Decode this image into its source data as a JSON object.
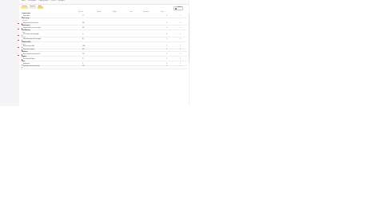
{
  "breadcrumb": [
    "Billing",
    "Cost allocation",
    "Usage by project",
    "Q4 2023",
    "All regions"
  ],
  "chips": [
    "Overview",
    "By project",
    "Alerts"
  ],
  "settings_label": "Settings",
  "columns": [
    "Total cost",
    "Forecast",
    "Budget",
    "Used",
    "Remaining",
    "Trend"
  ],
  "accent": "#e2474b",
  "rows": [
    {
      "kind": "section",
      "name": "Compute engine"
    },
    {
      "kind": "item",
      "name": "Project alpha",
      "icon": "#e2474b",
      "values": [
        "1.2",
        "",
        "",
        "",
        "",
        "0",
        "1"
      ],
      "pin": false
    },
    {
      "kind": "section",
      "name": "Cloud storage"
    },
    {
      "kind": "sub",
      "name": "Standard tier"
    },
    {
      "kind": "item",
      "name": "Backups bucket (archive class)",
      "icon": "#e2474b",
      "values": [
        "430",
        "",
        "",
        "",
        "",
        "0",
        "3"
      ],
      "pin": true
    },
    {
      "kind": "section",
      "name": "Network egress"
    },
    {
      "kind": "item",
      "name": "Regional traffic (us-east to eu-west)",
      "icon": "#e2474b",
      "values": [
        "285",
        "",
        "",
        "",
        "",
        "1",
        "1"
      ],
      "pin": true
    },
    {
      "kind": "section",
      "name": "Load balancing"
    },
    {
      "kind": "sub",
      "name": "Global"
    },
    {
      "kind": "item",
      "name": "HTTPS proxy rules (forwarding)",
      "icon": "#e2474b",
      "values": [
        "12",
        "",
        "",
        "",
        "",
        "0",
        "2"
      ],
      "pin": true
    },
    {
      "kind": "sub",
      "name": "Internal"
    },
    {
      "kind": "item",
      "name": "Internal forwarding rules (managed)",
      "icon": "#e2474b",
      "values": [
        "86",
        "",
        "",
        "",
        "",
        "1",
        "0"
      ],
      "pin": true
    },
    {
      "kind": "section",
      "name": "Databases (SQL)"
    },
    {
      "kind": "sub",
      "name": "Primary"
    },
    {
      "kind": "item",
      "name": "Primary instance (HA)",
      "icon": "#e2474b",
      "values": [
        "1,640",
        "",
        "",
        "",
        "",
        "2",
        "1"
      ],
      "pin": true
    },
    {
      "kind": "item",
      "name": "Read replica (regional)",
      "icon": "#e2474b",
      "values": [
        "920",
        "",
        "",
        "",
        "",
        "0",
        "1"
      ],
      "pin": false
    },
    {
      "kind": "section",
      "name": "Monitoring"
    },
    {
      "kind": "item",
      "name": "Metrics ingestion (custom metrics)",
      "icon": "#e2474b",
      "values": [
        "310",
        "",
        "",
        "",
        "",
        "0",
        "1"
      ],
      "pin": true
    },
    {
      "kind": "section",
      "name": "Logging"
    },
    {
      "kind": "item",
      "name": "Log retention (30 days)",
      "icon": "#e2474b",
      "values": [
        "75",
        "",
        "",
        "",
        "",
        "1",
        "1"
      ],
      "pin": false
    },
    {
      "kind": "section",
      "name": "Other"
    },
    {
      "kind": "item",
      "name": "Support plan",
      "icon": "#e2474b",
      "values": [
        "0",
        "",
        "",
        "",
        "",
        "0",
        "1"
      ],
      "pin": false
    },
    {
      "kind": "item",
      "name": "Marketplace licenses (third party)",
      "icon": "#e2474b",
      "values": [
        "150",
        "",
        "",
        "",
        "",
        "0",
        "1"
      ],
      "pin": false
    }
  ]
}
